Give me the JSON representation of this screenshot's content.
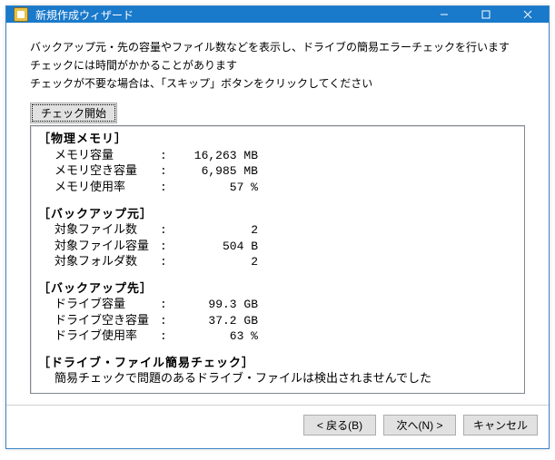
{
  "window": {
    "title": "新規作成ウィザード"
  },
  "description": {
    "line1": "バックアップ元・先の容量やファイル数などを表示し、ドライブの簡易エラーチェックを行います",
    "line2": "チェックには時間がかかることがあります",
    "line3": "チェックが不要な場合は、「スキップ」ボタンをクリックしてください"
  },
  "buttons": {
    "check_start": "チェック開始",
    "back": "< 戻る(B)",
    "next": "次へ(N) >",
    "cancel": "キャンセル"
  },
  "sections": {
    "memory": {
      "label": "［物理メモリ］",
      "rows": [
        {
          "name": "メモリ容量",
          "value": "16,263 MB"
        },
        {
          "name": "メモリ空き容量",
          "value": "6,985 MB"
        },
        {
          "name": "メモリ使用率",
          "value": "57 %"
        }
      ]
    },
    "source": {
      "label": "［バックアップ元］",
      "rows": [
        {
          "name": "対象ファイル数",
          "value": "2"
        },
        {
          "name": "対象ファイル容量",
          "value": "504 B"
        },
        {
          "name": "対象フォルダ数",
          "value": "2"
        }
      ]
    },
    "dest": {
      "label": "［バックアップ先］",
      "rows": [
        {
          "name": "ドライブ容量",
          "value": "99.3 GB"
        },
        {
          "name": "ドライブ空き容量",
          "value": "37.2 GB"
        },
        {
          "name": "ドライブ使用率",
          "value": "63 %"
        }
      ]
    },
    "check": {
      "label": "［ドライブ・ファイル簡易チェック］",
      "message": "簡易チェックで問題のあるドライブ・ファイルは検出されませんでした"
    }
  }
}
